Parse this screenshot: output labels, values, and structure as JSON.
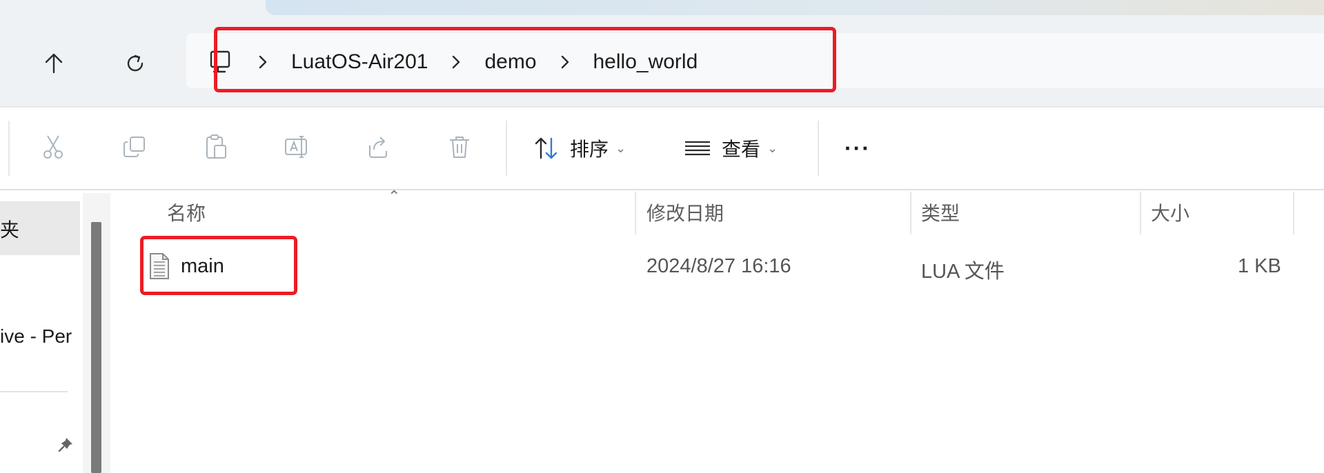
{
  "address_bar": {
    "breadcrumbs": [
      "LuatOS-Air201",
      "demo",
      "hello_world"
    ],
    "root_icon": "computer-icon",
    "separator_icon": "chevron-right-icon"
  },
  "nav": {
    "up_icon": "arrow-up-icon",
    "refresh_icon": "refresh-icon"
  },
  "toolbar": {
    "cut_icon": "scissors-icon",
    "copy_icon": "copy-icon",
    "paste_icon": "clipboard-icon",
    "rename_icon": "rename-icon",
    "share_icon": "share-icon",
    "delete_icon": "trash-icon",
    "sort_label": "排序",
    "view_label": "查看",
    "more_label": "···"
  },
  "sidebar": {
    "items": [
      {
        "label": "夹"
      },
      {
        "label": "ive - Per"
      }
    ],
    "pin_icon": "pin-icon"
  },
  "file_list": {
    "columns": [
      {
        "label": "名称"
      },
      {
        "label": "修改日期"
      },
      {
        "label": "类型"
      },
      {
        "label": "大小"
      }
    ],
    "rows": [
      {
        "name": "main",
        "modified": "2024/8/27 16:16",
        "type": "LUA 文件",
        "size": "1 KB",
        "icon": "text-file-icon"
      }
    ]
  },
  "colors": {
    "highlight": "#ec1c24",
    "chrome_background": "#eef2f5",
    "sort_accent": "#2b7cd3"
  }
}
